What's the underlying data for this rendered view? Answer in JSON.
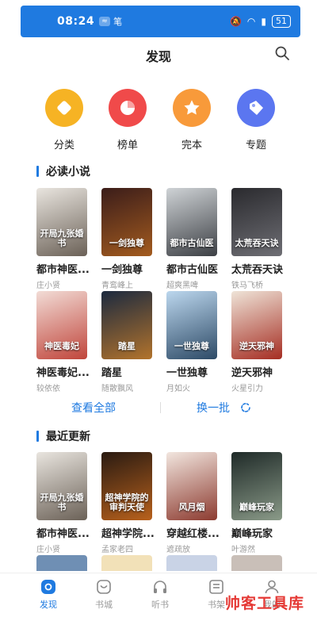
{
  "status": {
    "time": "08:24",
    "battery": "51"
  },
  "header": {
    "title": "发现"
  },
  "categories": [
    {
      "label": "分类",
      "icon": "category-icon",
      "color": "#f6b324"
    },
    {
      "label": "榜单",
      "icon": "chart-icon",
      "color": "#f04a4a"
    },
    {
      "label": "完本",
      "icon": "star-icon",
      "color": "#f89a3a"
    },
    {
      "label": "专题",
      "icon": "tag-icon",
      "color": "#5b76f0"
    }
  ],
  "must_read": {
    "title": "必读小说",
    "books": [
      {
        "title": "都市神医...",
        "author": "庄小贤",
        "cover_text": "开局九张婚书",
        "c1": "#e9e5df",
        "c2": "#6b6157"
      },
      {
        "title": "一剑独尊",
        "author": "青鸾峰上",
        "cover_text": "一剑独尊",
        "c1": "#3b1d1a",
        "c2": "#a35b1f"
      },
      {
        "title": "都市古仙医",
        "author": "超爽黑啤",
        "cover_text": "都市古仙医",
        "c1": "#cfd3d6",
        "c2": "#3c3f44"
      },
      {
        "title": "太荒吞天诀",
        "author": "铁马飞桥",
        "cover_text": "太荒吞天诀",
        "c1": "#2a2a2e",
        "c2": "#6e6e74"
      },
      {
        "title": "神医毒妃...",
        "author": "较依依",
        "cover_text": "神医毒妃",
        "c1": "#f2dcd6",
        "c2": "#c0453b"
      },
      {
        "title": "踏星",
        "author": "随散飘风",
        "cover_text": "踏星",
        "c1": "#1c2a3f",
        "c2": "#b2732c"
      },
      {
        "title": "一世独尊",
        "author": "月如火",
        "cover_text": "一世独尊",
        "c1": "#bcd7ee",
        "c2": "#2d4a66"
      },
      {
        "title": "逆天邪神",
        "author": "火星引力",
        "cover_text": "逆天邪神",
        "c1": "#efe4d8",
        "c2": "#a52d22"
      }
    ]
  },
  "actions": {
    "view_all": "查看全部",
    "refresh": "换一批"
  },
  "recent": {
    "title": "最近更新",
    "books": [
      {
        "title": "都市神医...",
        "author": "庄小贤",
        "cover_text": "开局九张婚书",
        "c1": "#e9e5df",
        "c2": "#6b6157"
      },
      {
        "title": "超神学院...",
        "author": "孟家老四",
        "cover_text": "超神学院的审判天使",
        "c1": "#2a1b12",
        "c2": "#b8611c"
      },
      {
        "title": "穿越红楼...",
        "author": "遮疏放",
        "cover_text": "风月烟",
        "c1": "#f2e6df",
        "c2": "#8c3a2f"
      },
      {
        "title": "巅峰玩家",
        "author": "叶游然",
        "cover_text": "巅峰玩家",
        "c1": "#1f2a28",
        "c2": "#8a9a88"
      }
    ]
  },
  "tabs": [
    {
      "label": "发现",
      "icon": "discover-icon",
      "active": true
    },
    {
      "label": "书城",
      "icon": "store-icon",
      "active": false
    },
    {
      "label": "听书",
      "icon": "headphones-icon",
      "active": false
    },
    {
      "label": "书架",
      "icon": "bookshelf-icon",
      "active": false
    },
    {
      "label": "我的",
      "icon": "user-icon",
      "active": false
    }
  ],
  "watermark": "帅客工具库"
}
